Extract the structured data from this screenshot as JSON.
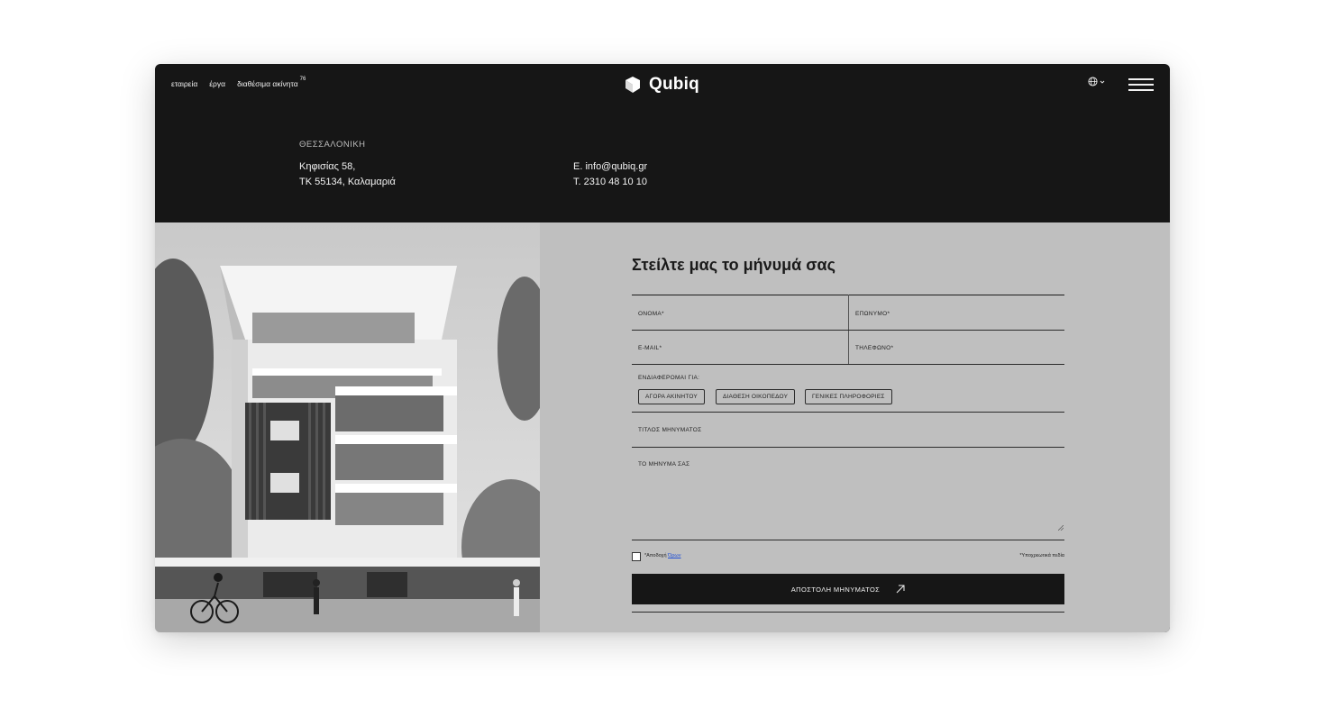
{
  "header": {
    "nav": [
      {
        "label": "εταιρεία"
      },
      {
        "label": "έργα"
      },
      {
        "label": "διαθέσιμα ακίνητα",
        "badge": "76"
      }
    ],
    "logo_text": "Qubiq"
  },
  "contact": {
    "city": "ΘΕΣΣΑΛΟΝΙΚΗ",
    "address_line1": "Κηφισίας 58,",
    "address_line2": "ΤΚ 55134, Καλαμαριά",
    "email": "E. info@qubiq.gr",
    "phone": "T. 2310 48 10 10"
  },
  "form": {
    "title": "Στείλτε μας το μήνυμά σας",
    "first_name": "ΟΝΟΜΑ*",
    "last_name": "ΕΠΩΝΥΜΟ*",
    "email": "E-MAIL*",
    "phone": "ΤΗΛΕΦΩΝΟ*",
    "interest_label": "ΕΝΔΙΑΦΕΡΟΜΑΙ ΓΙΑ:",
    "options": [
      "ΑΓΟΡΑ ΑΚΙΝΗΤΟΥ",
      "ΔΙΑΘΕΣΗ ΟΙΚΟΠΕΔΟΥ",
      "ΓΕΝΙΚΕΣ ΠΛΗΡΟΦΟΡΙΕΣ"
    ],
    "subject": "ΤΙΤΛΟΣ ΜΗΝΥΜΑΤΟΣ",
    "message": "ΤΟ ΜΗΝΥΜΑ ΣΑΣ",
    "accept_prefix": "*Αποδοχή",
    "accept_link": "Όρων",
    "required_note": "*Υποχρεωτικά πεδία",
    "submit": "ΑΠΟΣΤΟΛΗ ΜΗΝΥΜΑΤΟΣ"
  },
  "colors": {
    "dark": "#161616",
    "panel": "#bfbfbf",
    "link": "#1f4fd6"
  }
}
